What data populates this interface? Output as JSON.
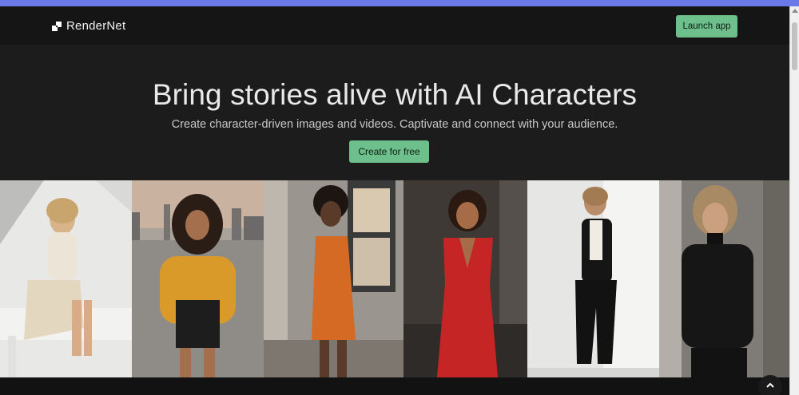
{
  "brand": {
    "name": "RenderNet",
    "logo_icon": "rendernet-logo-icon"
  },
  "nav": {
    "launch_label": "Launch app"
  },
  "hero": {
    "title": "Bring stories alive with AI Characters",
    "subtitle": "Create character-driven images and videos. Captivate and connect with your audience.",
    "cta_label": "Create for free"
  },
  "gallery": {
    "images": [
      {
        "name": "character-image-cream-outfit"
      },
      {
        "name": "character-image-yellow-sweater"
      },
      {
        "name": "character-image-orange-dress"
      },
      {
        "name": "character-image-red-dress"
      },
      {
        "name": "character-image-black-suit"
      },
      {
        "name": "character-image-leather-jacket"
      }
    ]
  },
  "colors": {
    "accent": "#6dbf8b",
    "top_bar": "#6a78e8",
    "background": "#1c1c1c"
  },
  "icons": {
    "back_to_top": "chevron-up-icon"
  }
}
